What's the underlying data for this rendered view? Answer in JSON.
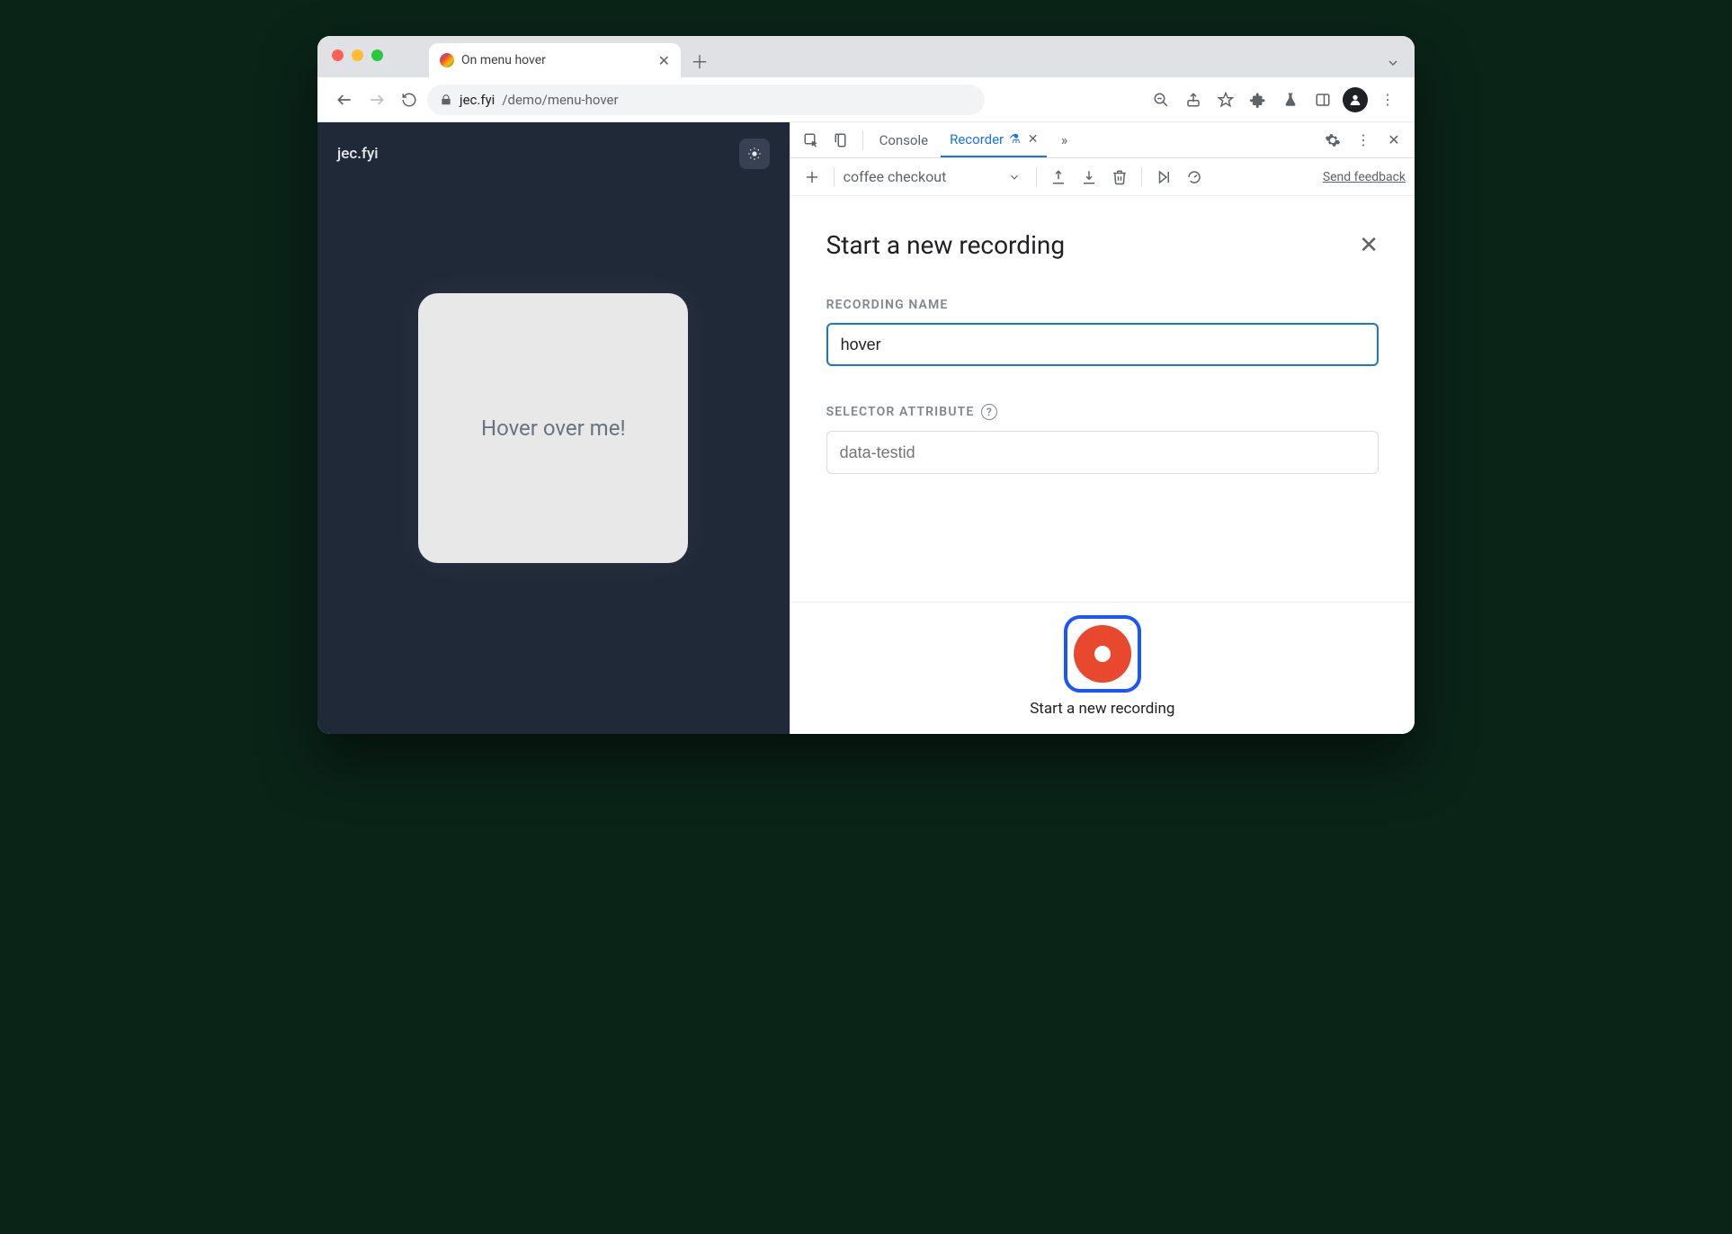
{
  "window": {
    "tab_title": "On menu hover",
    "url_host": "jec.fyi",
    "url_path": "/demo/menu-hover"
  },
  "page": {
    "brand": "jec.fyi",
    "card_text": "Hover over me!"
  },
  "devtools": {
    "tabs": {
      "console": "Console",
      "recorder": "Recorder"
    },
    "recorder": {
      "dropdown_value": "coffee checkout",
      "feedback": "Send feedback",
      "heading": "Start a new recording",
      "name_label": "RECORDING NAME",
      "name_value": "hover",
      "selector_label": "SELECTOR ATTRIBUTE",
      "selector_placeholder": "data-testid",
      "start_label": "Start a new recording"
    }
  }
}
